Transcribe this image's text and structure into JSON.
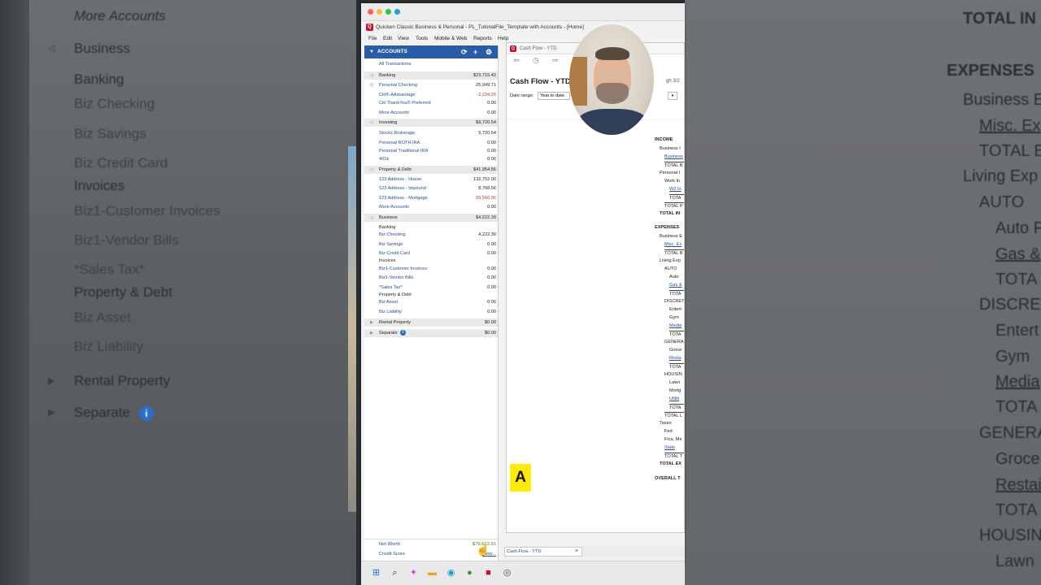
{
  "left_panel": {
    "items": [
      {
        "label": "More Accounts",
        "style": "italic"
      },
      {
        "label": "Business",
        "style": "group"
      },
      {
        "label": "Banking",
        "style": "plain"
      },
      {
        "label": "Biz Checking",
        "style": "link"
      },
      {
        "label": "Biz Savings",
        "style": "link"
      },
      {
        "label": "Biz Credit Card",
        "style": "link"
      },
      {
        "label": "Invoices",
        "style": "plain"
      },
      {
        "label": "Biz1-Customer Invoices",
        "style": "link"
      },
      {
        "label": "Biz1-Vendor Bills",
        "style": "link"
      },
      {
        "label": "*Sales Tax*",
        "style": "link"
      },
      {
        "label": "Property & Debt",
        "style": "plain"
      },
      {
        "label": "Biz Asset",
        "style": "link"
      },
      {
        "label": "Biz Liability",
        "style": "link"
      },
      {
        "label": "Rental Property",
        "style": "group"
      },
      {
        "label": "Separate",
        "style": "group"
      }
    ]
  },
  "right_panel": {
    "items": [
      {
        "label": "TOTAL IN"
      },
      {
        "label": "EXPENSES"
      },
      {
        "label": "Business E"
      },
      {
        "label": "Misc. Ex"
      },
      {
        "label": "TOTAL E"
      },
      {
        "label": "Living Exp"
      },
      {
        "label": "AUTO"
      },
      {
        "label": "Auto F"
      },
      {
        "label": "Gas &"
      },
      {
        "label": "TOTA"
      },
      {
        "label": "DISCRET"
      },
      {
        "label": "Entert"
      },
      {
        "label": "Gym"
      },
      {
        "label": "Media"
      },
      {
        "label": "TOTA"
      },
      {
        "label": "GENERA"
      },
      {
        "label": "Groce"
      },
      {
        "label": "Restai"
      },
      {
        "label": "TOTA"
      },
      {
        "label": "HOUSIN"
      },
      {
        "label": "Lawn"
      }
    ]
  },
  "window": {
    "title": "Quicken Classic Business & Personal - PL_TutorialFile_Template with Accounts - [Home]",
    "menu": [
      "File",
      "Edit",
      "View",
      "Tools",
      "Mobile & Web",
      "Reports",
      "Help"
    ]
  },
  "accounts": {
    "header": "ACCOUNTS",
    "all_transactions": "All Transactions",
    "rows": [
      {
        "name": "Banking",
        "value": "$23,715.42",
        "kind": "group"
      },
      {
        "name": "Personal Checking",
        "value": "25,949.71",
        "kind": "acct"
      },
      {
        "name": "Citi®-AAdvantage",
        "value": "-2,234.29",
        "kind": "neg"
      },
      {
        "name": "Citi ThankYou® Preferred",
        "value": "0.00",
        "kind": "acct"
      },
      {
        "name": "More Accounts",
        "value": "0.00",
        "kind": "more"
      },
      {
        "name": "Investing",
        "value": "$9,720.54",
        "kind": "group"
      },
      {
        "name": "Stocks Brokerage",
        "value": "9,720.54",
        "kind": "acct"
      },
      {
        "name": "Personal ROTH IRA",
        "value": "0.00",
        "kind": "acct"
      },
      {
        "name": "Personal Traditional IRA",
        "value": "0.00",
        "kind": "acct"
      },
      {
        "name": "401k",
        "value": "0.00",
        "kind": "acct"
      },
      {
        "name": "Property & Debt",
        "value": "$41,954.56",
        "kind": "group"
      },
      {
        "name": "123 Address - House",
        "value": "132,752.00",
        "kind": "acct"
      },
      {
        "name": "123 Address - Impound",
        "value": "8,768.56",
        "kind": "acct"
      },
      {
        "name": "123 Address - Mortgage",
        "value": "-99,566.00",
        "kind": "neg"
      },
      {
        "name": "More Accounts",
        "value": "0.00",
        "kind": "more"
      },
      {
        "name": "Business",
        "value": "$4,222.39",
        "kind": "group"
      },
      {
        "name": "Banking",
        "value": "",
        "kind": "sub"
      },
      {
        "name": "Biz Checking",
        "value": "4,222.39",
        "kind": "acct"
      },
      {
        "name": "Biz Savings",
        "value": "0.00",
        "kind": "acct"
      },
      {
        "name": "Biz Credit Card",
        "value": "0.00",
        "kind": "acct"
      },
      {
        "name": "Invoices",
        "value": "",
        "kind": "sub"
      },
      {
        "name": "Biz1-Customer Invoices",
        "value": "0.00",
        "kind": "acct"
      },
      {
        "name": "Biz1-Vendor Bills",
        "value": "0.00",
        "kind": "acct"
      },
      {
        "name": "*Sales Tax*",
        "value": "0.00",
        "kind": "acct"
      },
      {
        "name": "Property & Debt",
        "value": "",
        "kind": "sub"
      },
      {
        "name": "Biz Asset",
        "value": "0.00",
        "kind": "acct"
      },
      {
        "name": "Biz Liability",
        "value": "0.00",
        "kind": "acct"
      },
      {
        "name": "Rental Property",
        "value": "$0.00",
        "kind": "group"
      },
      {
        "name": "Separate",
        "value": "$0.00",
        "kind": "group"
      }
    ],
    "net_worth_label": "Net Worth",
    "net_worth_value": "$79,612.91",
    "credit_score_label": "Credit Score",
    "credit_score_link": "View..."
  },
  "report": {
    "window_title": "Cash Flow - YTD",
    "heading": "Cash Flow - YTD",
    "subtitle": "gh 3/2",
    "date_range_label": "Date range:",
    "date_range_value": "Year to date",
    "lines": [
      {
        "t": "INCOME",
        "s": "b"
      },
      {
        "t": "Business I",
        "s": ""
      },
      {
        "t": "Business",
        "s": "u"
      },
      {
        "t": "TOTAL B",
        "s": "ol"
      },
      {
        "t": "Personal I",
        "s": ""
      },
      {
        "t": "Work In",
        "s": ""
      },
      {
        "t": "W2 In",
        "s": "u"
      },
      {
        "t": "TOTA",
        "s": "ol"
      },
      {
        "t": "TOTAL P",
        "s": "ol"
      },
      {
        "t": "TOTAL IN",
        "s": "b"
      },
      {
        "t": "EXPENSES",
        "s": "b"
      },
      {
        "t": "Business E",
        "s": ""
      },
      {
        "t": "Misc. Ex",
        "s": "u"
      },
      {
        "t": "TOTAL B",
        "s": "ol"
      },
      {
        "t": "Living Exp",
        "s": ""
      },
      {
        "t": "AUTO",
        "s": ""
      },
      {
        "t": "Auto",
        "s": ""
      },
      {
        "t": "Gas &",
        "s": "u"
      },
      {
        "t": "TOTA",
        "s": "ol"
      },
      {
        "t": "DISCRET",
        "s": ""
      },
      {
        "t": "Entert",
        "s": ""
      },
      {
        "t": "Gym",
        "s": ""
      },
      {
        "t": "Media",
        "s": "u"
      },
      {
        "t": "TOTA",
        "s": "ol"
      },
      {
        "t": "GENERA",
        "s": ""
      },
      {
        "t": "Groce",
        "s": ""
      },
      {
        "t": "Resta",
        "s": "u"
      },
      {
        "t": "TOTA",
        "s": "ol"
      },
      {
        "t": "HOUSIN",
        "s": ""
      },
      {
        "t": "Lawn",
        "s": ""
      },
      {
        "t": "Mortg",
        "s": ""
      },
      {
        "t": "Utiliti",
        "s": "u"
      },
      {
        "t": "TOTA",
        "s": "ol"
      },
      {
        "t": "TOTAL L",
        "s": "ol"
      },
      {
        "t": "Taxes",
        "s": ""
      },
      {
        "t": "Fed",
        "s": ""
      },
      {
        "t": "Fica, Me",
        "s": ""
      },
      {
        "t": "State",
        "s": "u"
      },
      {
        "t": "TOTAL T",
        "s": "ol"
      },
      {
        "t": "TOTAL EX",
        "s": "b"
      },
      {
        "t": "OVERALL T",
        "s": "b"
      }
    ],
    "badge": "A"
  },
  "bottom_tab": {
    "label": "Cash Flow - YTD",
    "close": "×"
  },
  "colors": {
    "accent": "#2a5da8",
    "brand": "#c8102e",
    "negative": "#c0392b",
    "positive": "#2e7d32",
    "badge": "#ffeb00"
  }
}
